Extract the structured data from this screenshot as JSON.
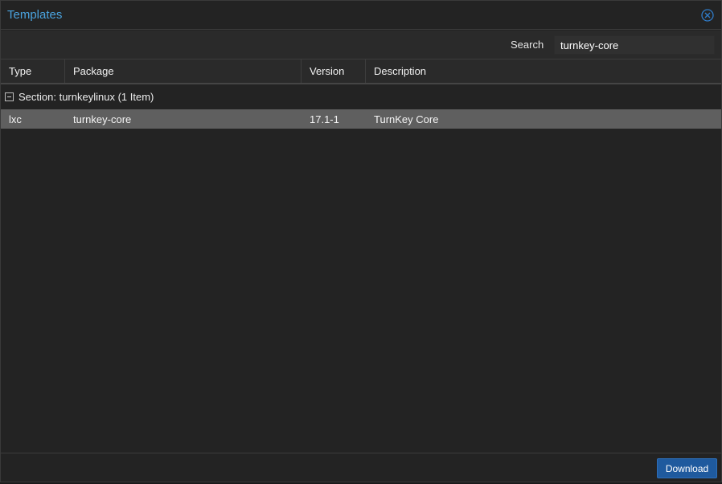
{
  "window": {
    "title": "Templates"
  },
  "search": {
    "label": "Search",
    "value": "turnkey-core",
    "placeholder": ""
  },
  "columns": {
    "type": "Type",
    "package": "Package",
    "version": "Version",
    "description": "Description"
  },
  "group": {
    "label": "Section: turnkeylinux (1 Item)"
  },
  "rows": [
    {
      "type": "lxc",
      "package": "turnkey-core",
      "version": "17.1-1",
      "description": "TurnKey Core",
      "selected": true
    }
  ],
  "footer": {
    "download_label": "Download"
  },
  "colors": {
    "accent": "#4aa3df",
    "button": "#1f5a9e",
    "selected_row": "#5f5f5f",
    "background": "#232323"
  },
  "icons": {
    "close": "close-circle-icon",
    "collapse": "collapse-minus-icon"
  }
}
